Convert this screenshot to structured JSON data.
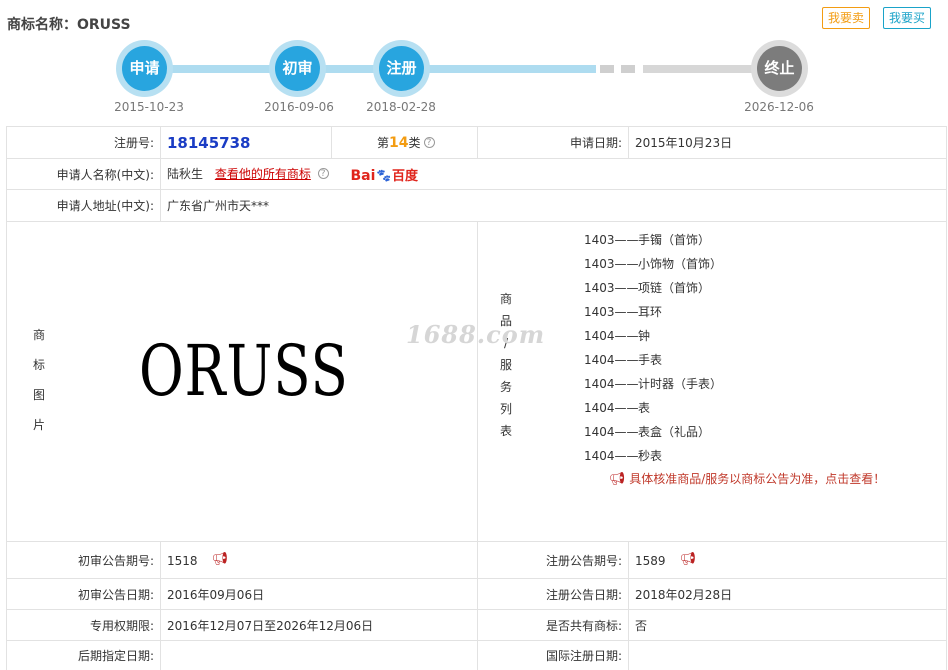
{
  "header": {
    "title": "商标名称：ORUSS",
    "sell_label": "我要卖",
    "buy_label": "我要买"
  },
  "timeline": {
    "steps": [
      {
        "label": "申请",
        "date": "2015-10-23"
      },
      {
        "label": "初审",
        "date": "2016-09-06"
      },
      {
        "label": "注册",
        "date": "2018-02-28"
      },
      {
        "label": "终止",
        "date": "2026-12-06"
      }
    ]
  },
  "details": {
    "reg_no_label": "注册号:",
    "reg_no": "18145738",
    "class_prefix": "第",
    "class_num": "14",
    "class_suffix": "类",
    "apply_date_label": "申请日期:",
    "apply_date": "2015年10月23日",
    "applicant_label": "申请人名称(中文):",
    "applicant": "陆秋生",
    "all_marks_link": "查看他的所有商标",
    "baidu_bai": "Bai",
    "baidu_cn": "百度",
    "address_label": "申请人地址(中文):",
    "address": "广东省广州市天***",
    "image_label_chars": [
      "商",
      "标",
      "图",
      "片"
    ],
    "mark_text": "ORUSS",
    "goods_label_chars": [
      "商",
      "品",
      "/",
      "服",
      "务",
      "列",
      "表"
    ],
    "goods": [
      {
        "code": "1403——",
        "name": "手镯（首饰）"
      },
      {
        "code": "1403——",
        "name": "小饰物（首饰）"
      },
      {
        "code": "1403——",
        "name": "项链（首饰）"
      },
      {
        "code": "1403——",
        "name": "耳环"
      },
      {
        "code": "1404——",
        "name": "钟"
      },
      {
        "code": "1404——",
        "name": "手表"
      },
      {
        "code": "1404——",
        "name": "计时器（手表）"
      },
      {
        "code": "1404——",
        "name": "表"
      },
      {
        "code": "1404——",
        "name": "表盒（礼品）"
      },
      {
        "code": "1404——",
        "name": "秒表"
      }
    ],
    "goods_notice": "具体核准商品/服务以商标公告为准，点击查看！",
    "watermark": "1688.com",
    "prelim_no_label": "初审公告期号:",
    "prelim_no": "1518",
    "reg_pub_no_label": "注册公告期号:",
    "reg_pub_no": "1589",
    "prelim_date_label": "初审公告日期:",
    "prelim_date": "2016年09月06日",
    "reg_pub_date_label": "注册公告日期:",
    "reg_pub_date": "2018年02月28日",
    "exclusive_label": "专用权期限:",
    "exclusive_period": "2016年12月07日至2026年12月06日",
    "shared_label": "是否共有商标:",
    "shared": "否",
    "later_label": "后期指定日期:",
    "later": "",
    "intl_label": "国际注册日期:",
    "intl": ""
  }
}
